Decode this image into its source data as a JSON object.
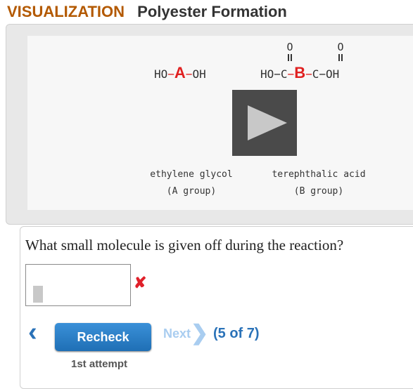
{
  "header": {
    "kicker": "VISUALIZATION",
    "title": "Polyester Formation"
  },
  "visualization": {
    "glycol": {
      "left": "HO",
      "group": "A",
      "right": "OH",
      "caption_name": "ethylene glycol",
      "caption_group": "(A group)"
    },
    "acid": {
      "left": "HO",
      "c1": "C",
      "group": "B",
      "c2": "C",
      "right": "OH",
      "oxygen": "O",
      "caption_name": "terephthalic acid",
      "caption_group": "(B group)"
    },
    "play_icon": "play-icon"
  },
  "question": {
    "prompt": "What small molecule is given off during the reaction?",
    "answer_value": "",
    "status_icon": "x-mark-icon",
    "status_color": "#e0202a"
  },
  "navigation": {
    "recheck_label": "Recheck",
    "next_label": "Next",
    "progress": "(5 of 7)",
    "attempt": "1st attempt"
  },
  "colors": {
    "accent": "#2a72b8",
    "kicker": "#b35900",
    "group": "#e02020"
  }
}
